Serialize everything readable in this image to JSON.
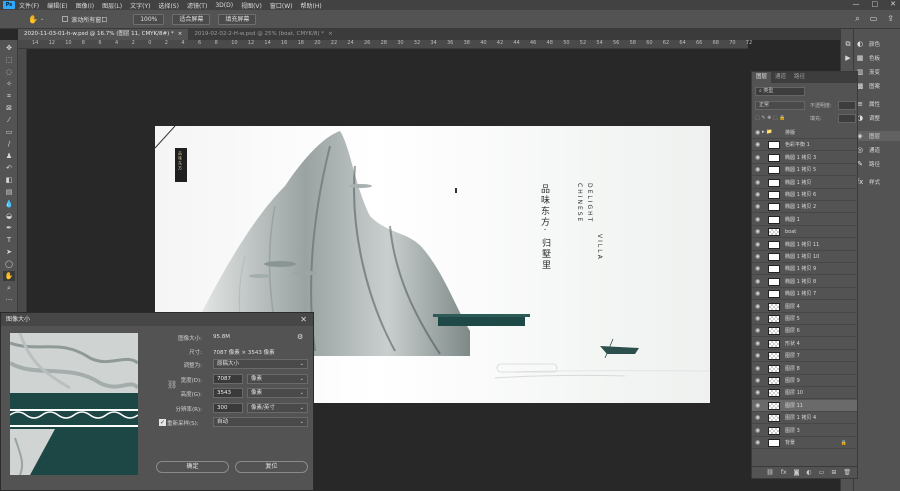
{
  "menubar": {
    "logo": "Ps",
    "items": [
      "文件(F)",
      "编辑(E)",
      "图像(I)",
      "图层(L)",
      "文字(Y)",
      "选择(S)",
      "滤镜(T)",
      "3D(D)",
      "视图(V)",
      "窗口(W)",
      "帮助(H)"
    ],
    "window_controls": [
      "—",
      "□",
      "✕"
    ]
  },
  "options": {
    "scroll_all": "滚动所有窗口",
    "zoom": "100%",
    "fit_screen": "适合屏幕",
    "fill_screen": "填充屏幕"
  },
  "tabs": [
    {
      "label": "2020-11-03-01-h-w.psd @ 16.7% (图层 11, CMYK/8#) *",
      "active": true
    },
    {
      "label": "2019-02-02-2-H-w.psd @ 25% (boat, CMYK/8) *",
      "active": false
    }
  ],
  "ruler": {
    "ticks": [
      "14",
      "12",
      "10",
      "8",
      "6",
      "4",
      "2",
      "0",
      "2",
      "4",
      "6",
      "8",
      "10",
      "12",
      "14",
      "16",
      "18",
      "20",
      "22",
      "24",
      "26",
      "28",
      "30",
      "32",
      "34",
      "36",
      "38",
      "40",
      "42",
      "44",
      "46",
      "48",
      "50",
      "52",
      "54",
      "56",
      "58",
      "60",
      "62",
      "64",
      "66",
      "68",
      "70",
      "72"
    ]
  },
  "artwork": {
    "vertical_small": "品味东方",
    "title_cn_col1": "品味东方·",
    "title_cn_col2": "归墅里",
    "title_en_col1": "CHINESE",
    "title_en_col2": "DELIGHT",
    "title_en_col3": "VILLA"
  },
  "dialog": {
    "title": "图像大小",
    "image_size_label": "图像大小:",
    "image_size_value": "95.8M",
    "dimensions_label": "尺寸:",
    "dimensions_value": "7087 像素 × 3543 像素",
    "fit_to_label": "调整为:",
    "fit_to_value": "原稿大小",
    "width_label": "宽度(D):",
    "width_value": "7087",
    "width_unit": "像素",
    "height_label": "高度(G):",
    "height_value": "3543",
    "height_unit": "像素",
    "resolution_label": "分辨率(R):",
    "resolution_value": "300",
    "resolution_unit": "像素/英寸",
    "resample_label": "重新采样(S):",
    "resample_value": "自动",
    "ok": "确定",
    "reset": "复位"
  },
  "layers_panel": {
    "tabs": [
      "图层",
      "通道",
      "路径"
    ],
    "kind": "类型",
    "blend": "正常",
    "opacity_label": "不透明度:",
    "fill_label": "填充:",
    "rows": [
      {
        "name": "排版",
        "type": "folder"
      },
      {
        "name": "色彩平衡 1",
        "type": "adjust"
      },
      {
        "name": "椭圆 1 拷贝 3",
        "type": "shape"
      },
      {
        "name": "椭圆 1 拷贝 5",
        "type": "shape"
      },
      {
        "name": "椭圆 1 拷贝",
        "type": "shape"
      },
      {
        "name": "椭圆 1 拷贝 6",
        "type": "shape"
      },
      {
        "name": "椭圆 1 拷贝 2",
        "type": "shape"
      },
      {
        "name": "椭圆 1",
        "type": "shape"
      },
      {
        "name": "boat",
        "type": "layer"
      },
      {
        "name": "椭圆 1 拷贝 11",
        "type": "shape"
      },
      {
        "name": "椭圆 1 拷贝 10",
        "type": "shape"
      },
      {
        "name": "椭圆 1 拷贝 9",
        "type": "shape"
      },
      {
        "name": "椭圆 1 拷贝 8",
        "type": "shape"
      },
      {
        "name": "椭圆 1 拷贝 7",
        "type": "shape"
      },
      {
        "name": "图层 4",
        "type": "layer"
      },
      {
        "name": "图层 5",
        "type": "layer"
      },
      {
        "name": "图层 6",
        "type": "layer"
      },
      {
        "name": "形状 4",
        "type": "layer"
      },
      {
        "name": "图层 7",
        "type": "layer"
      },
      {
        "name": "图层 8",
        "type": "layer"
      },
      {
        "name": "图层 9",
        "type": "layer"
      },
      {
        "name": "图层 10",
        "type": "layer"
      },
      {
        "name": "图层 11",
        "type": "layer",
        "selected": true
      },
      {
        "name": "图层 1 拷贝 4",
        "type": "layer"
      },
      {
        "name": "图层 3",
        "type": "layer"
      },
      {
        "name": "背景",
        "type": "background",
        "lock": "🔒"
      }
    ]
  },
  "right_panels": [
    {
      "label": "颜色",
      "icon": "palette-icon"
    },
    {
      "label": "色板",
      "icon": "swatches-icon"
    },
    {
      "label": "渐变",
      "icon": "gradient-icon"
    },
    {
      "label": "图案",
      "icon": "pattern-icon"
    },
    {
      "label": "属性",
      "icon": "properties-icon"
    },
    {
      "label": "调整",
      "icon": "adjustments-icon"
    },
    {
      "label": "图层",
      "icon": "layers-icon",
      "active": true
    },
    {
      "label": "通道",
      "icon": "channels-icon"
    },
    {
      "label": "路径",
      "icon": "paths-icon"
    },
    {
      "label": "样式",
      "icon": "styles-icon"
    }
  ]
}
